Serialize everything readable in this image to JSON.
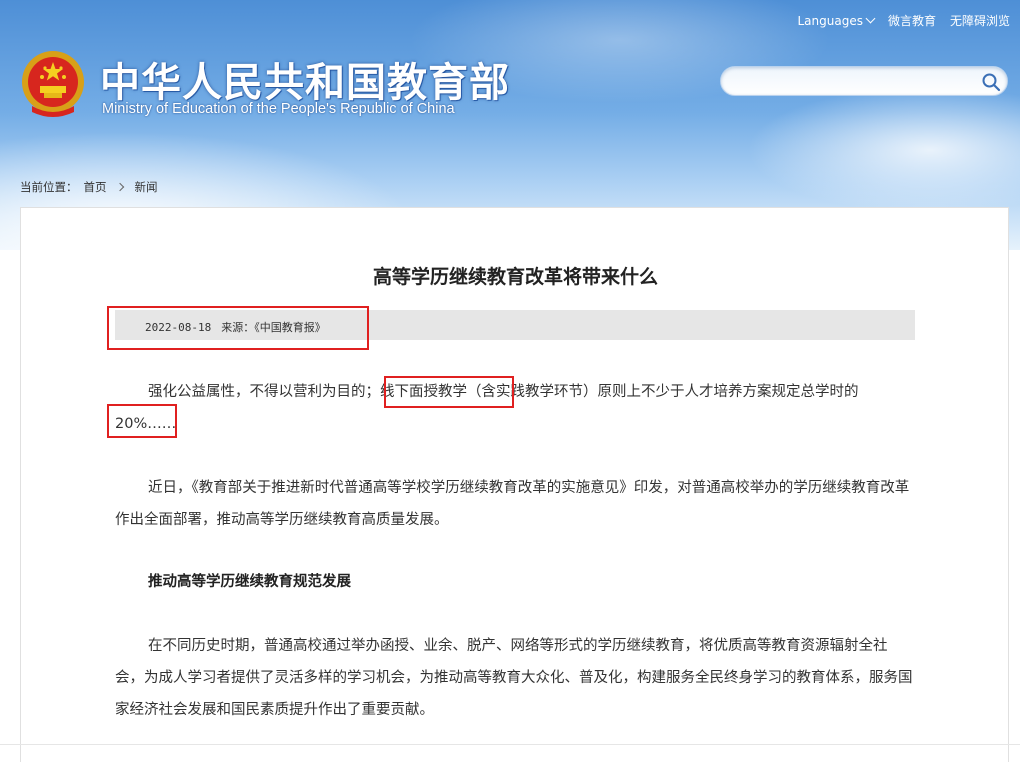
{
  "header": {
    "top_links": {
      "languages": "Languages",
      "weiyan": "微言教育",
      "accessibility": "无障碍浏览"
    },
    "site_title": "中华人民共和国教育部",
    "site_subtitle": "Ministry of Education of the People's Republic of China",
    "search": {
      "value": "",
      "placeholder": ""
    }
  },
  "breadcrumb": {
    "label": "当前位置：",
    "home": "首页",
    "current": "新闻"
  },
  "article": {
    "title": "高等学历继续教育改革将带来什么",
    "date": "2022-08-18",
    "source": "来源：《中国教育报》",
    "paragraphs": [
      "强化公益属性，不得以营利为目的；线下面授教学（含实践教学环节）原则上不少于人才培养方案规定总学时的20%……",
      "近日，《教育部关于推进新时代普通高等学校学历继续教育改革的实施意见》印发，对普通高校举办的学历继续教育改革作出全面部署，推动高等学历继续教育高质量发展。",
      "推动高等学历继续教育规范发展",
      "在不同历史时期，普通高校通过举办函授、业余、脱产、网络等形式的学历继续教育，将优质高等教育资源辐射全社会，为成人学习者提供了灵活多样的学习机会，为推动高等教育大众化、普及化，构建服务全民终身学习的教育体系，服务国家经济社会发展和国民素质提升作出了重要贡献。"
    ]
  },
  "colors": {
    "highlight": "#e02020",
    "header_blue": "#4e8fd6",
    "meta_bar": "#e6e6e6"
  },
  "icons": [
    "national-emblem-icon",
    "chevron-down-icon",
    "search-icon",
    "chevron-right-icon"
  ]
}
